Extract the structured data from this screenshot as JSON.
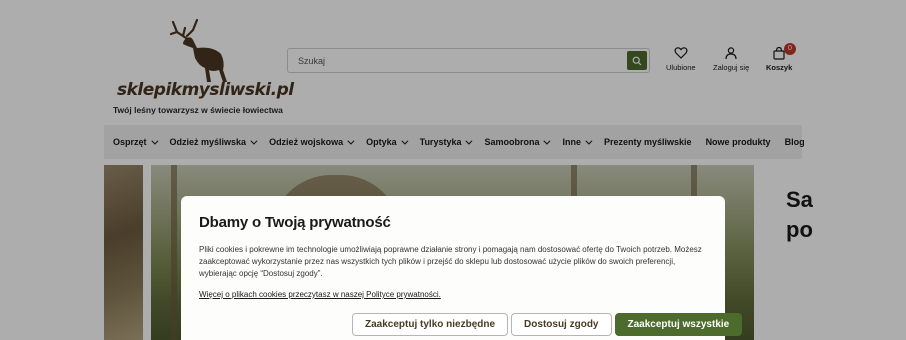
{
  "header": {
    "logo_text": "sklepikmysliwski",
    "logo_tld": ".pl",
    "tagline": "Twój leśny towarzysz w świecie łowiectwa",
    "search_placeholder": "Szukaj",
    "favorites_label": "Ulubione",
    "login_label": "Zaloguj się",
    "cart_label": "Koszyk",
    "cart_count": "0"
  },
  "nav": {
    "items": [
      {
        "label": "Osprzęt",
        "dropdown": true
      },
      {
        "label": "Odzież myśliwska",
        "dropdown": true
      },
      {
        "label": "Odzież wojskowa",
        "dropdown": true
      },
      {
        "label": "Optyka",
        "dropdown": true
      },
      {
        "label": "Turystyka",
        "dropdown": true
      },
      {
        "label": "Samoobrona",
        "dropdown": true
      },
      {
        "label": "Inne",
        "dropdown": true
      },
      {
        "label": "Prezenty myśliwskie",
        "dropdown": false
      },
      {
        "label": "Nowe produkty",
        "dropdown": false
      },
      {
        "label": "Blog",
        "dropdown": false
      }
    ]
  },
  "hero": {
    "right_text_line1": "Sa",
    "right_text_line2": "po"
  },
  "cookie": {
    "title": "Dbamy o Twoją prywatność",
    "body": "Pliki cookies i pokrewne im technologie umożliwiają poprawne działanie strony i pomagają nam dostosować ofertę do Twoich potrzeb. Możesz zaakceptować wykorzystanie przez nas wszystkich tych plików i przejść do sklepu lub dostosować użycie plików do swoich preferencji, wybierając opcję “Dostosuj zgody”.",
    "more_link": "Więcej o plikach cookies przeczytasz w naszej Polityce prywatności.",
    "btn_necessary": "Zaakceptuj tylko niezbędne",
    "btn_customize": "Dostosuj zgody",
    "btn_accept_all": "Zaakceptuj wszystkie"
  },
  "colors": {
    "brand_green": "#4c6b2c",
    "logo_brown": "#4a3522",
    "badge_red": "#c0392b"
  }
}
